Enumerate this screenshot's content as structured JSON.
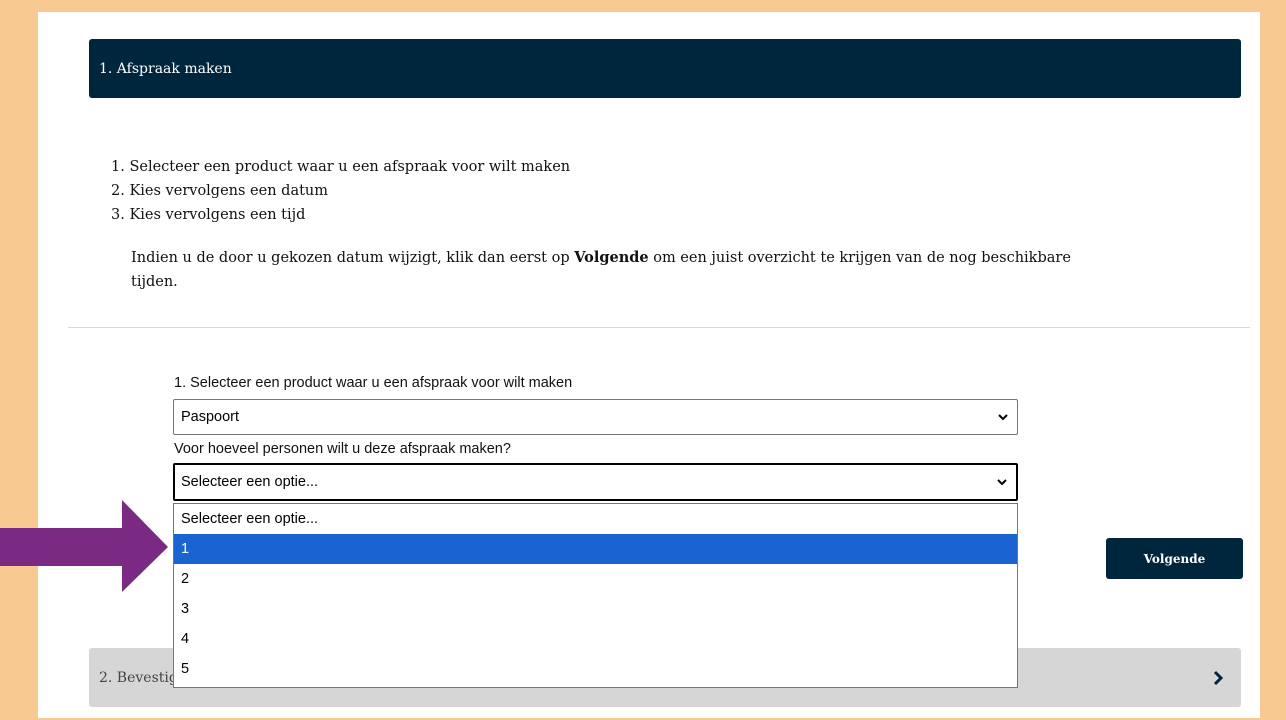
{
  "step1": {
    "header": "1. Afspraak maken",
    "instructions": [
      "1. Selecteer een product waar u een afspraak voor wilt maken",
      "2. Kies vervolgens een datum",
      "3. Kies vervolgens een tijd"
    ],
    "info_prefix": "Indien u de door u gekozen datum wijzigt, klik dan eerst op ",
    "info_bold": "Volgende",
    "info_suffix": " om een juist overzicht te krijgen van de nog beschikbare tijden."
  },
  "form": {
    "product_label": "1. Selecteer een product waar u een afspraak voor wilt maken",
    "product_value": "Paspoort",
    "persons_label": "Voor hoeveel personen wilt u deze afspraak maken?",
    "persons_value": "Selecteer een optie...",
    "persons_options": [
      "Selecteer een optie...",
      "1",
      "2",
      "3",
      "4",
      "5"
    ],
    "highlighted_option": "1"
  },
  "buttons": {
    "next": "Volgende"
  },
  "step2": {
    "header": "2. Bevestiging"
  },
  "colors": {
    "background": "#f8c990",
    "header_dark": "#00263e",
    "highlight": "#1a64d2",
    "arrow": "#7a2a82",
    "step2_bg": "#d6d6d6"
  },
  "icons": {
    "select_chevron": "chevron-down-icon",
    "step2_chevron": "chevron-right-icon",
    "annotation_arrow": "arrow-right-icon"
  }
}
